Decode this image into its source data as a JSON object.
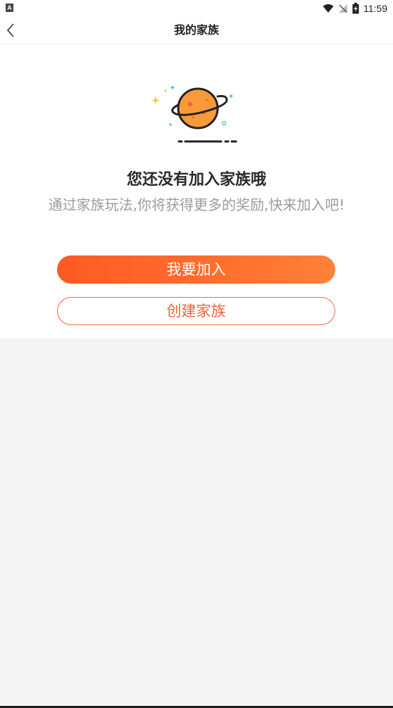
{
  "status_bar": {
    "time": "11:59",
    "notification_icon": "a-notification-icon",
    "wifi_icon": "wifi-icon",
    "signal_icon": "no-signal-icon",
    "battery_icon": "battery-charging-icon"
  },
  "header": {
    "title": "我的家族",
    "back_icon": "chevron-left-icon"
  },
  "empty_state": {
    "illustration": "planet-icon",
    "title": "您还没有加入家族哦",
    "description": "通过家族玩法,你将获得更多的奖励,快来加入吧!"
  },
  "actions": {
    "join_label": "我要加入",
    "create_label": "创建家族"
  },
  "colors": {
    "accent": "#ff5a24",
    "accent_text": "#f1623a",
    "background": "#f4f4f4"
  }
}
